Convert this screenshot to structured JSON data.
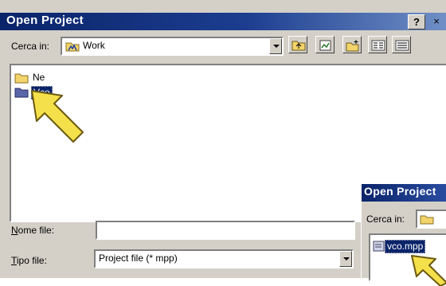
{
  "dialog": {
    "title": "Open Project",
    "help_button": "?",
    "close_button": "×",
    "look_in_label": "Cerca in:",
    "look_in_value": "Work",
    "files": [
      {
        "name": "Ne",
        "selected": false
      },
      {
        "name": "Vco",
        "selected": true
      }
    ],
    "filename_label_first": "N",
    "filename_label_rest": "ome file:",
    "filename_value": "",
    "filetype_label_first": "T",
    "filetype_label_rest": "ipo file:",
    "filetype_value": "Project file (* mpp)"
  },
  "overlay_dialog": {
    "title": "Open Project",
    "look_in_label": "Cerca in:",
    "files": [
      {
        "name": "vco.mpp",
        "selected": true
      }
    ]
  },
  "colors": {
    "title_bar": "#0a246a",
    "dialog_face": "#d4d0c8",
    "pointer_arrow": "#f4e04a"
  }
}
